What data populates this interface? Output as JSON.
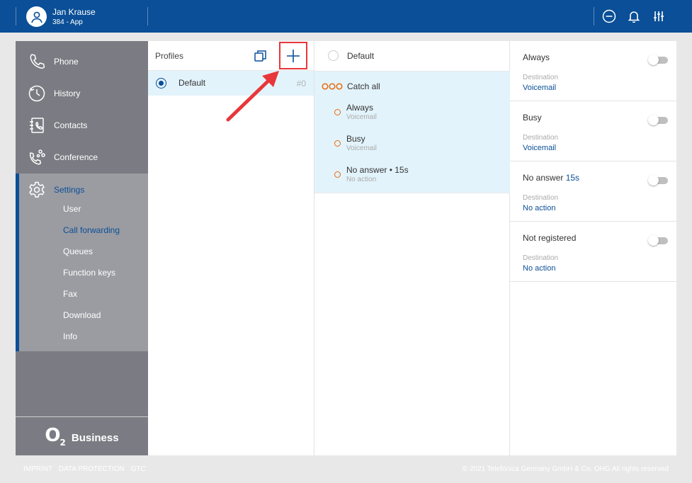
{
  "colors": {
    "header_bg": "#0a4f97",
    "accent_blue": "#0a4f97",
    "sidebar_bg": "#7b7c83",
    "sidebar_active_bg": "#9b9ca2",
    "orange": "#e96a0c",
    "highlight_bg": "#e3f3fb",
    "annotation_red": "#e8373a"
  },
  "header": {
    "user_name": "Jan Krause",
    "user_sub": "384 - App",
    "icons": [
      "minus-circle-icon",
      "bell-icon",
      "sliders-icon"
    ]
  },
  "sidebar": {
    "items": [
      {
        "label": "Phone",
        "icon": "phone-icon"
      },
      {
        "label": "History",
        "icon": "clock-icon"
      },
      {
        "label": "Contacts",
        "icon": "contacts-icon"
      },
      {
        "label": "Conference",
        "icon": "conference-icon"
      },
      {
        "label": "Settings",
        "icon": "gear-icon"
      }
    ],
    "settings_sub": [
      {
        "label": "User"
      },
      {
        "label": "Call forwarding"
      },
      {
        "label": "Queues"
      },
      {
        "label": "Function keys"
      },
      {
        "label": "Fax"
      },
      {
        "label": "Download"
      },
      {
        "label": "Info"
      }
    ],
    "brand_o": "O",
    "brand_sub": "2",
    "brand_business": "Business"
  },
  "profiles": {
    "heading": "Profiles",
    "items": [
      {
        "name": "Default",
        "number": "#0"
      }
    ]
  },
  "middle": {
    "title": "Default",
    "catch_all": "Catch all",
    "rules": [
      {
        "title": "Always",
        "sub": "Voicemail"
      },
      {
        "title": "Busy",
        "sub": "Voicemail"
      },
      {
        "title": "No answer • 15s",
        "sub": "No action"
      }
    ]
  },
  "right": {
    "dest_label": "Destination",
    "rows": [
      {
        "title": "Always",
        "extra": "",
        "dest": "Voicemail"
      },
      {
        "title": "Busy",
        "extra": "",
        "dest": "Voicemail"
      },
      {
        "title": "No answer",
        "extra": "15s",
        "dest": "No action"
      },
      {
        "title": "Not registered",
        "extra": "",
        "dest": "No action"
      }
    ]
  },
  "footer": {
    "links": [
      "IMPRINT",
      "DATA PROTECTION",
      "GTC"
    ],
    "copyright": "© 2021 Telefónica Germany GmbH & Co. OHG All rights reserved"
  }
}
